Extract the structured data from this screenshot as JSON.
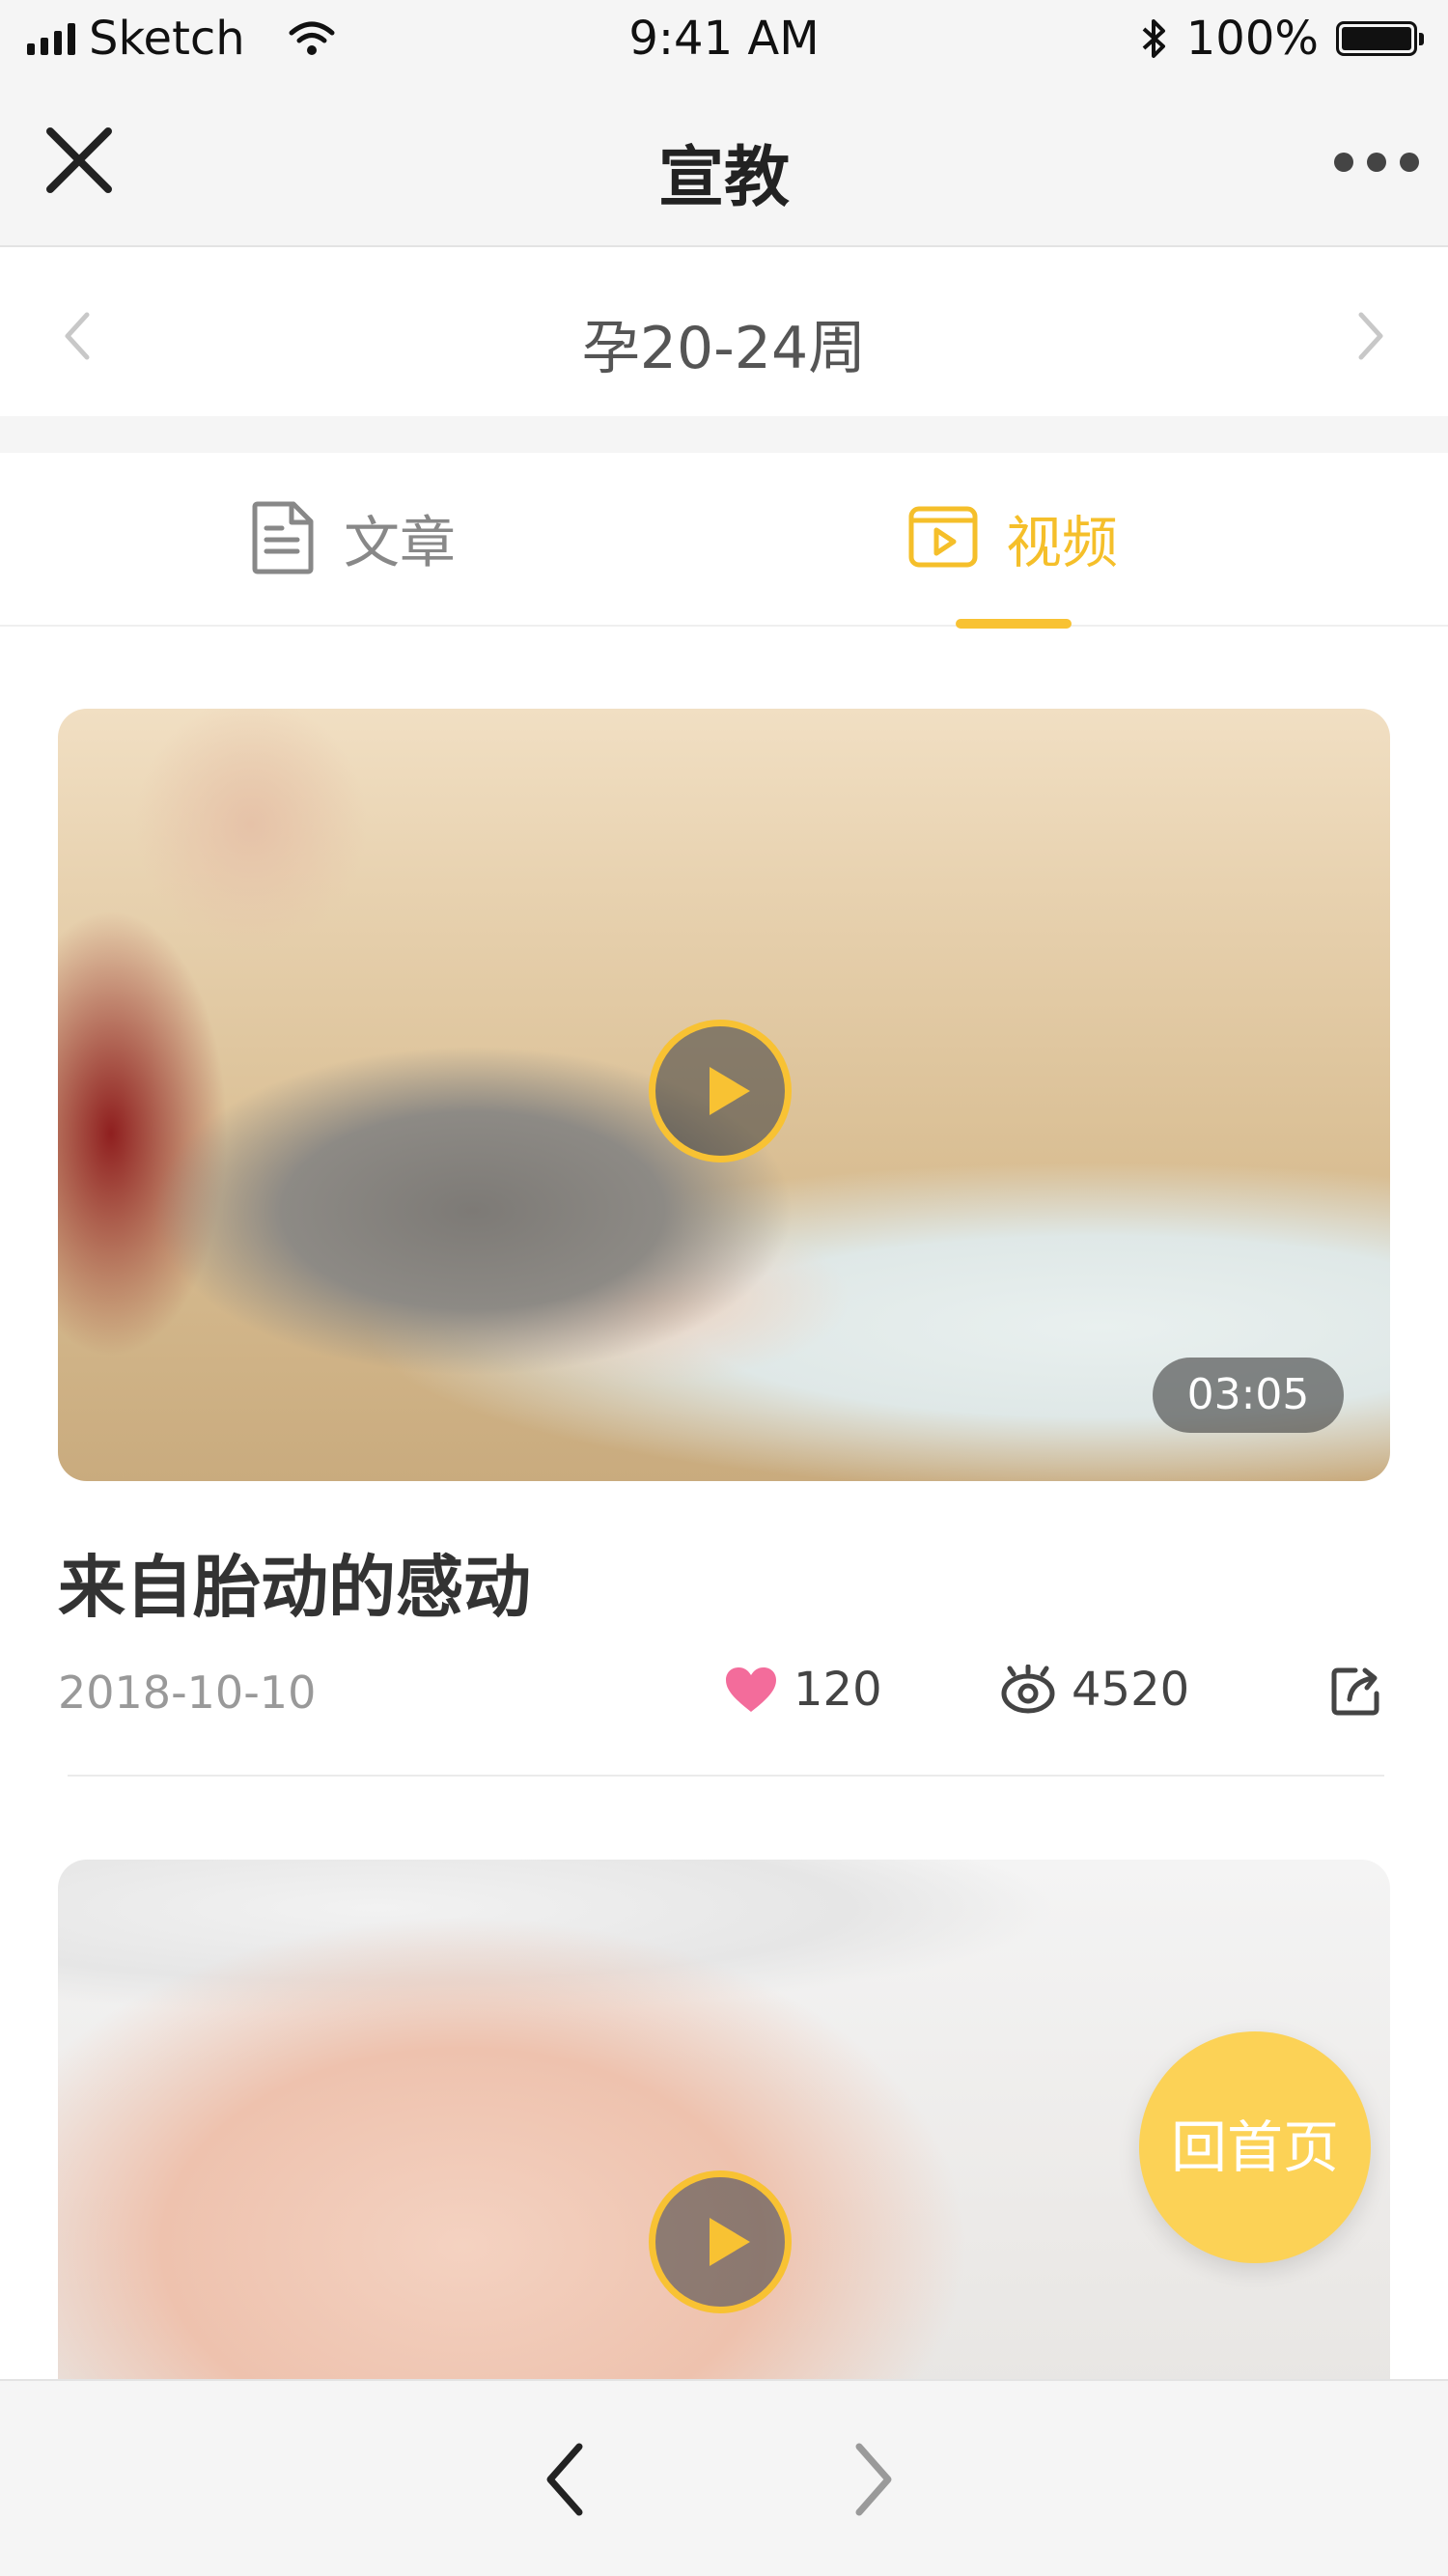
{
  "status_bar": {
    "carrier": "Sketch",
    "time": "9:41 AM",
    "battery": "100%",
    "battery_level": 1.0
  },
  "nav": {
    "title": "宣教",
    "close_icon": "close-icon",
    "more_icon": "more-icon"
  },
  "week_selector": {
    "label": "孕20-24周",
    "prev_icon": "chevron-left-icon",
    "next_icon": "chevron-right-icon"
  },
  "tabs": [
    {
      "label": "文章",
      "icon": "document-icon",
      "active": false
    },
    {
      "label": "视频",
      "icon": "video-icon",
      "active": true
    }
  ],
  "videos": [
    {
      "title": "来自胎动的感动",
      "date": "2018-10-10",
      "duration": "03:05",
      "likes": "120",
      "views": "4520"
    },
    {
      "title": "",
      "date": "",
      "duration": "",
      "likes": "",
      "views": ""
    }
  ],
  "home_button": {
    "label": "回首页"
  },
  "colors": {
    "accent": "#f8c233",
    "like": "#f36c9b",
    "background": "#f5f5f5"
  }
}
